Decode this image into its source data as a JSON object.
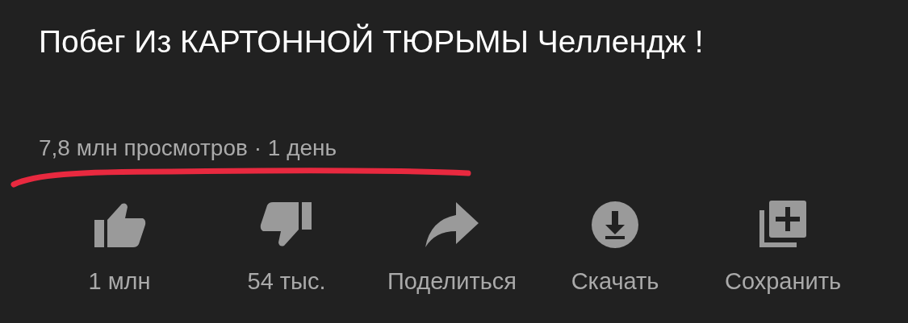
{
  "video": {
    "title": "Побег Из КАРТОННОЙ ТЮРЬМЫ Челлендж !",
    "meta": "7,8 млн просмотров · 1 день"
  },
  "actions": [
    {
      "kind": "like",
      "label": "1 млн"
    },
    {
      "kind": "dislike",
      "label": "54 тыс."
    },
    {
      "kind": "share",
      "label": "Поделиться"
    },
    {
      "kind": "download",
      "label": "Скачать"
    },
    {
      "kind": "save",
      "label": "Сохранить"
    }
  ]
}
